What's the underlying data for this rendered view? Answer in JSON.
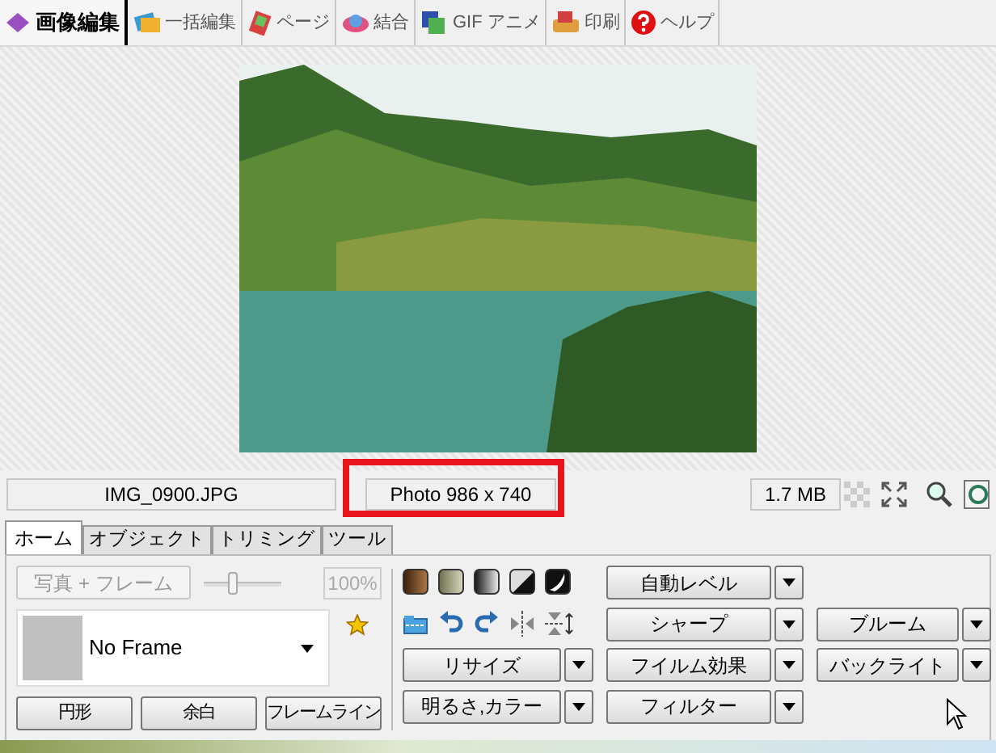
{
  "toolbar_tabs": [
    {
      "label": "画像編集",
      "selected": true
    },
    {
      "label": "一括編集",
      "selected": false
    },
    {
      "label": "ページ",
      "selected": false
    },
    {
      "label": "結合",
      "selected": false
    },
    {
      "label": "GIF アニメ",
      "selected": false
    },
    {
      "label": "印刷",
      "selected": false
    },
    {
      "label": "ヘルプ",
      "selected": false
    }
  ],
  "status_bar": {
    "filename": "IMG_0900.JPG",
    "dimensions": "Photo 986 x 740",
    "size": "1.7 MB"
  },
  "panel_tabs": [
    {
      "label": "ホーム",
      "selected": true
    },
    {
      "label": "オブジェクト",
      "selected": false
    },
    {
      "label": "トリミング",
      "selected": false
    },
    {
      "label": "ツール",
      "selected": false
    }
  ],
  "photo_frame_button": {
    "label": "写真 + フレーム",
    "disabled": true
  },
  "frame_slider": {
    "level": 0.35,
    "disabled": true
  },
  "zoom_field": {
    "value": "100%",
    "disabled": true
  },
  "frame_dropdown": {
    "value": "No Frame"
  },
  "frame_buttons": [
    "円形",
    "余白",
    "フレームライン"
  ],
  "split_button_columns": [
    [
      "リサイズ",
      "明るさ,カラー"
    ],
    [
      "自動レベル",
      "シャープ",
      "フイルム効果",
      "フィルター"
    ],
    [
      "ブルーム",
      "バックライト"
    ]
  ]
}
